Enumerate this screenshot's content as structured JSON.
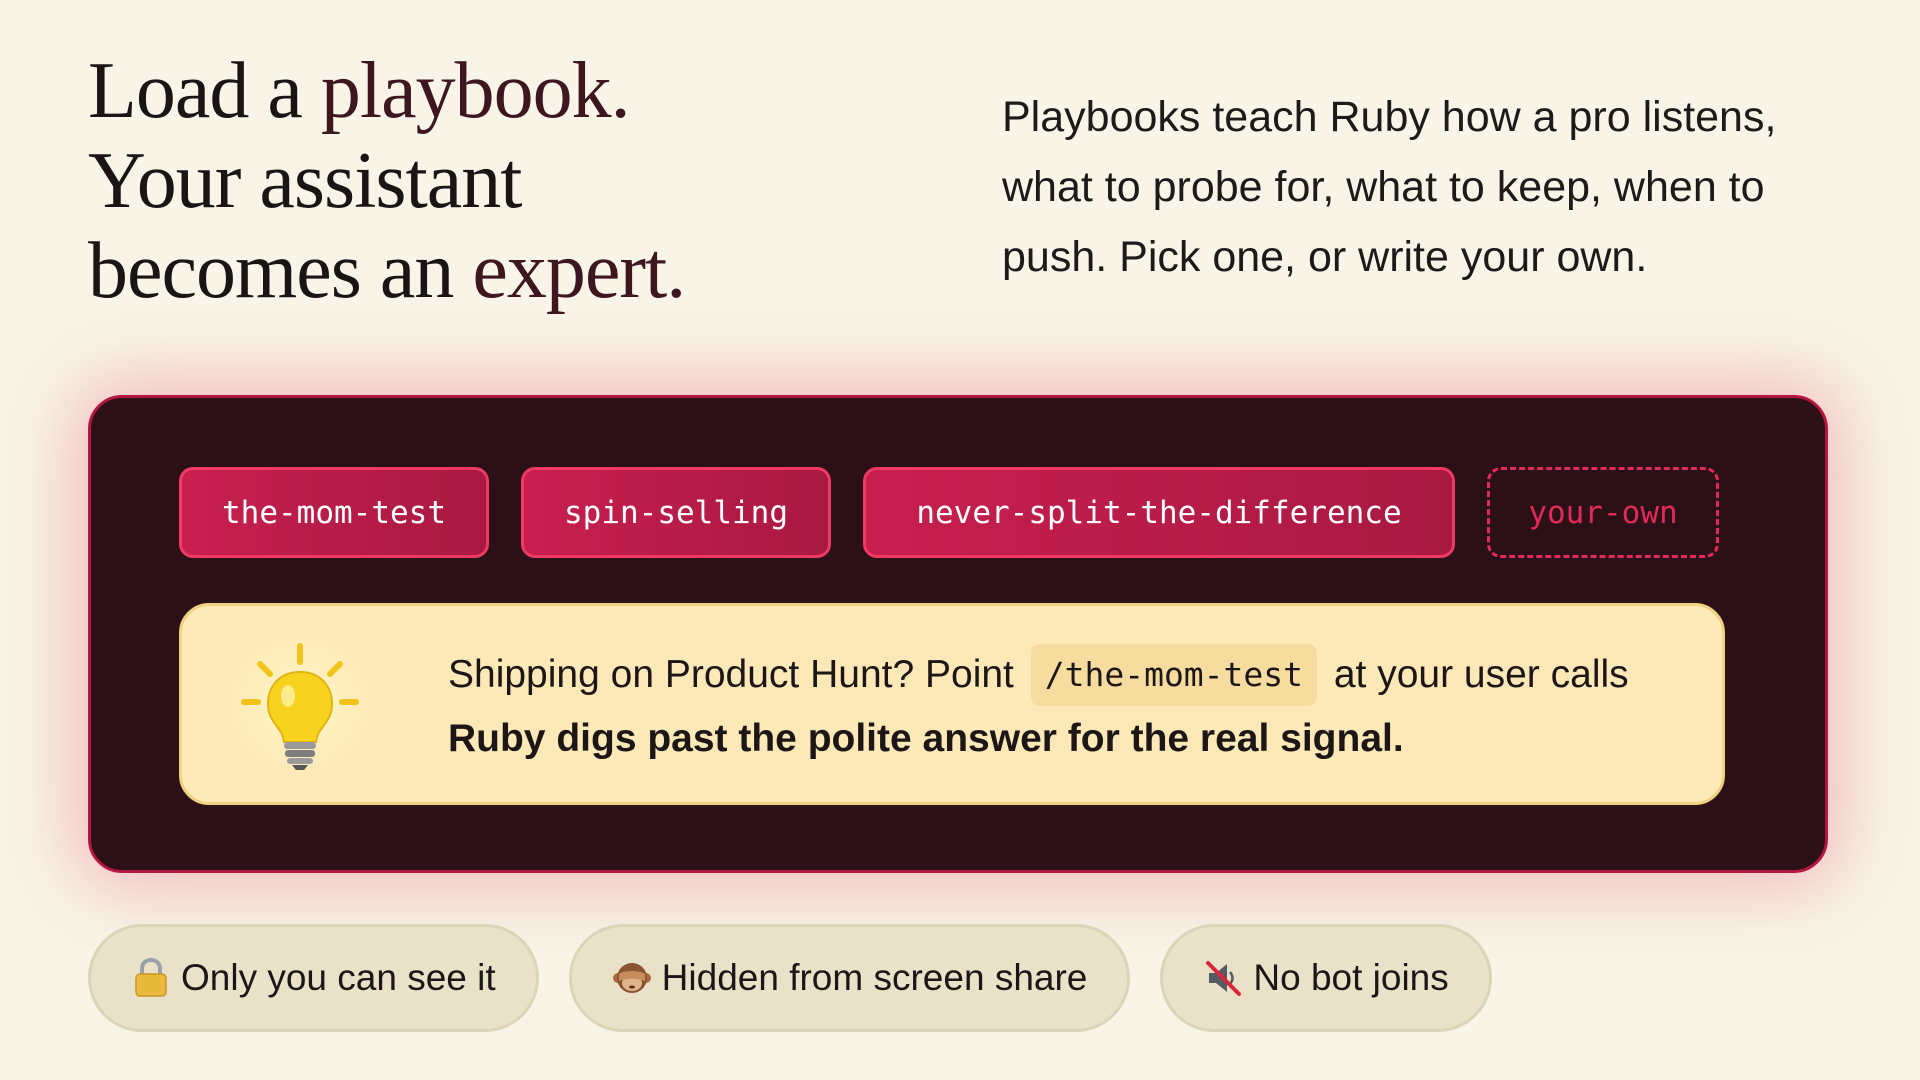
{
  "headline": {
    "line1_plain": "Load a ",
    "line1_accent": "playbook.",
    "line2": "Your assistant",
    "line3_plain": "becomes an ",
    "line3_accent": "expert."
  },
  "intro": "Playbooks teach Ruby how a pro listens, what to probe for, what to keep, when to push. Pick one, or write your own.",
  "playbooks": [
    {
      "label": "the-mom-test"
    },
    {
      "label": "spin-selling"
    },
    {
      "label": "never-split-the-difference"
    },
    {
      "label": "your-own"
    }
  ],
  "callout": {
    "icon": "lightbulb-icon",
    "text_before": "Shipping on Product Hunt? Point",
    "code": "/the-mom-test",
    "text_after": "at your user calls",
    "bold_line": "Ruby digs past the polite answer for the real signal."
  },
  "badges": [
    {
      "icon": "lock-icon",
      "label": "Only you can see it"
    },
    {
      "icon": "see-no-evil-monkey-icon",
      "label": "Hidden from screen share"
    },
    {
      "icon": "muted-speaker-icon",
      "label": "No bot joins"
    }
  ],
  "colors": {
    "background": "#f8f5e8",
    "panel": "#2b1117",
    "accent": "#c81f4f",
    "callout": "#fde9b8"
  }
}
